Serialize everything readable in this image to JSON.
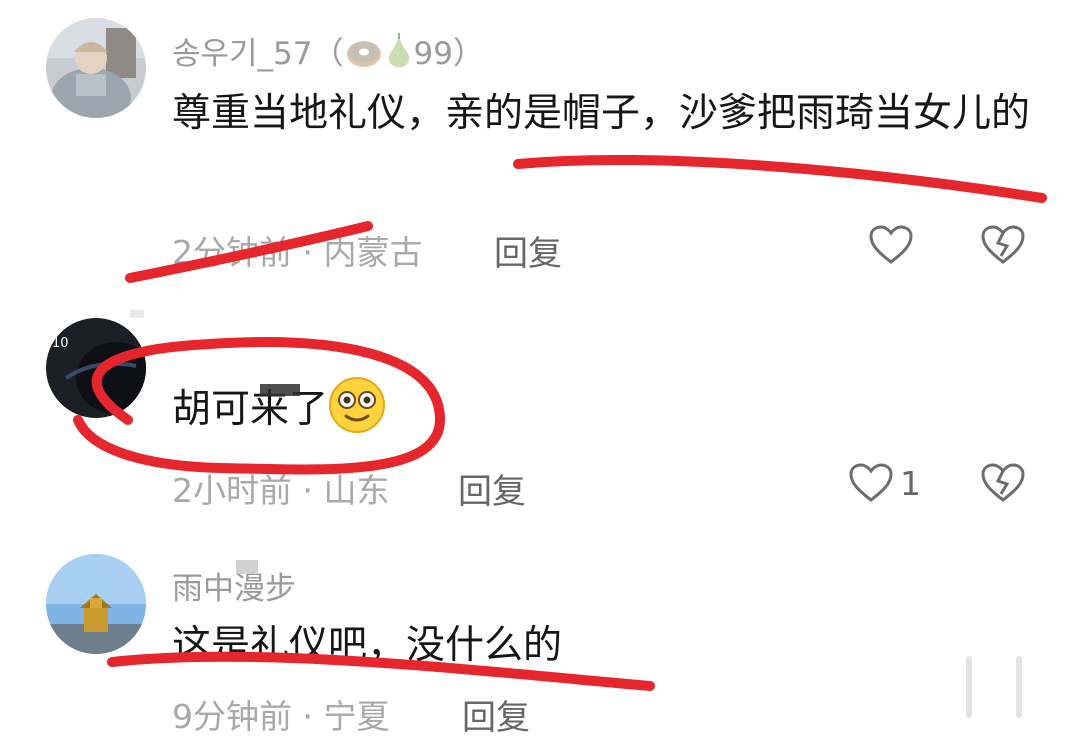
{
  "comments": [
    {
      "username": "송우기_57（",
      "badge_value": "99）",
      "content": "尊重当地礼仪，亲的是帽子，沙爹把雨琦当女儿的",
      "time": "2分钟前",
      "location": "内蒙古",
      "reply": "回复"
    },
    {
      "content_text": "胡可来了",
      "time": "2小时前",
      "location": "山东",
      "reply": "回复",
      "like_count": "1"
    },
    {
      "username": "雨中漫步",
      "content": "这是礼仪吧，没什么的",
      "time": "9分钟前",
      "location": "宁夏",
      "reply": "回复"
    }
  ],
  "avatar_label": "10",
  "separator": " · ",
  "colors": {
    "red_annotation": "#e5262d",
    "text": "#161616",
    "meta": "#a8a8a8"
  },
  "icons": [
    "heart-icon",
    "broken-heart-icon",
    "donut-icon",
    "pear-icon",
    "smile-emoji-icon"
  ]
}
